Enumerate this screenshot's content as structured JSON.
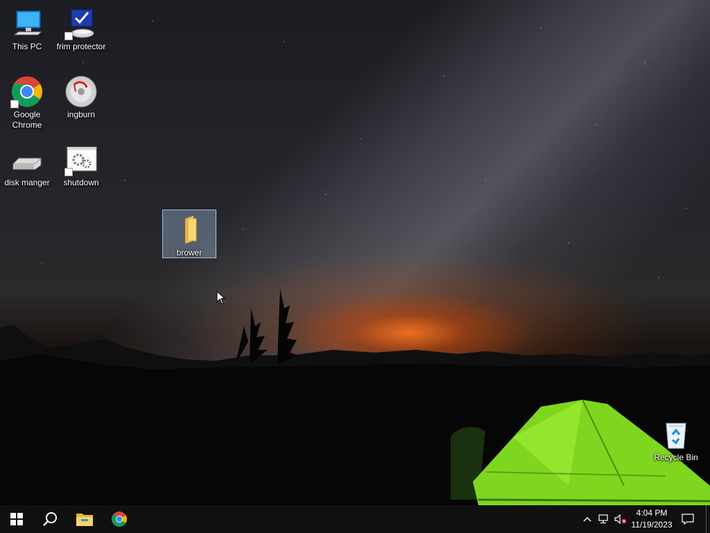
{
  "desktop": {
    "icons": [
      {
        "label": "This PC",
        "icon": "this-pc-icon"
      },
      {
        "label": "frim protector",
        "icon": "frim-protector-icon"
      },
      {
        "label": "Google Chrome",
        "icon": "google-chrome-icon"
      },
      {
        "label": "ingburn",
        "icon": "imgburn-disc-icon"
      },
      {
        "label": "disk manger",
        "icon": "disk-drive-icon"
      },
      {
        "label": "shutdown",
        "icon": "shutdown-gears-icon"
      },
      {
        "label": "brower",
        "icon": "folder-icon",
        "selected": true
      },
      {
        "label": "Recycle Bin",
        "icon": "recycle-bin-icon"
      }
    ]
  },
  "taskbar": {
    "pinned": [
      "start-icon",
      "search-icon",
      "file-explorer-icon",
      "chrome-icon"
    ],
    "tray": [
      "chevron-up-icon",
      "network-icon",
      "volume-muted-icon"
    ],
    "time": "4:04 PM",
    "date": "11/19/2023"
  },
  "colors": {
    "taskbar": "#101010",
    "selection": "#9fbedc",
    "tent": "#8bdc28"
  }
}
